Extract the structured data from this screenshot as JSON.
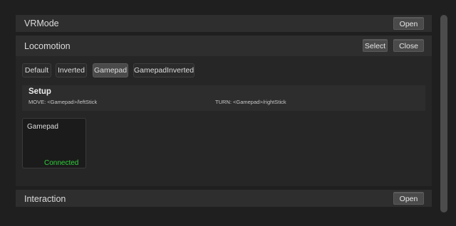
{
  "panels": {
    "vrmode": {
      "title": "VRMode",
      "open_label": "Open"
    },
    "locomotion": {
      "title": "Locomotion",
      "select_label": "Select",
      "close_label": "Close",
      "modes": [
        "Default",
        "Inverted",
        "Gamepad",
        "GamepadInverted"
      ],
      "active_mode": "Gamepad",
      "setup": {
        "title": "Setup",
        "move": "MOVE: <Gamepad>/leftStick",
        "turn": "TURN: <Gamepad>/rightStick"
      },
      "device": {
        "name": "Gamepad",
        "status": "Connected"
      }
    },
    "interaction": {
      "title": "Interaction",
      "open_label": "Open"
    }
  },
  "colors": {
    "background": "#1f1f1f",
    "panel_header": "#2e2e2e",
    "button": "#4a4a4a",
    "status_connected": "#2fd03a"
  }
}
